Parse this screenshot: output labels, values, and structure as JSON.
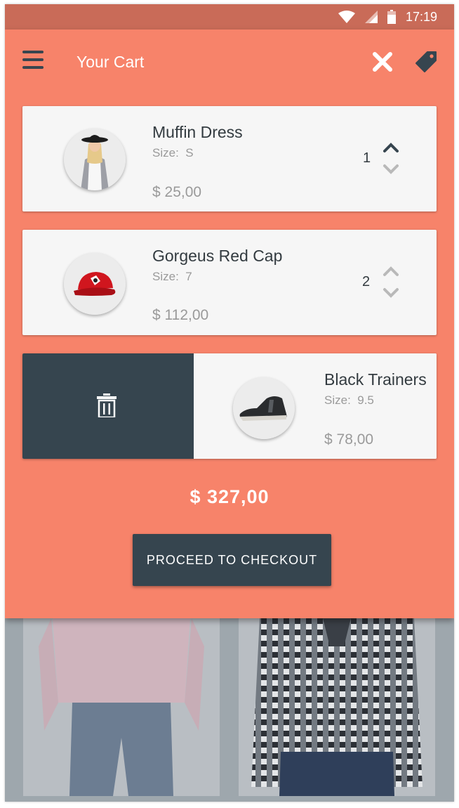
{
  "status_bar": {
    "time": "17:19"
  },
  "app_bar": {
    "title": "Your Cart"
  },
  "cart": {
    "items": [
      {
        "name": "Muffin Dress",
        "size_label": "Size:",
        "size": "S",
        "price": "$ 25,00",
        "quantity": "1"
      },
      {
        "name": "Gorgeus Red Cap",
        "size_label": "Size:",
        "size": "7",
        "price": "$ 112,00",
        "quantity": "2"
      },
      {
        "name": "Black Trainers",
        "size_label": "Size:",
        "size": "9.5",
        "price": "$ 78,00"
      }
    ],
    "total": "$ 327,00",
    "checkout_label": "PROCEED TO CHECKOUT"
  },
  "colors": {
    "accent": "#f7836a",
    "status_bar": "#c96b58",
    "dark": "#36454f",
    "card": "#f6f6f6"
  },
  "icons": [
    "menu-icon",
    "close-icon",
    "tag-icon",
    "chevron-up-icon",
    "chevron-down-icon",
    "trash-icon",
    "wifi-icon",
    "signal-icon",
    "battery-icon"
  ]
}
